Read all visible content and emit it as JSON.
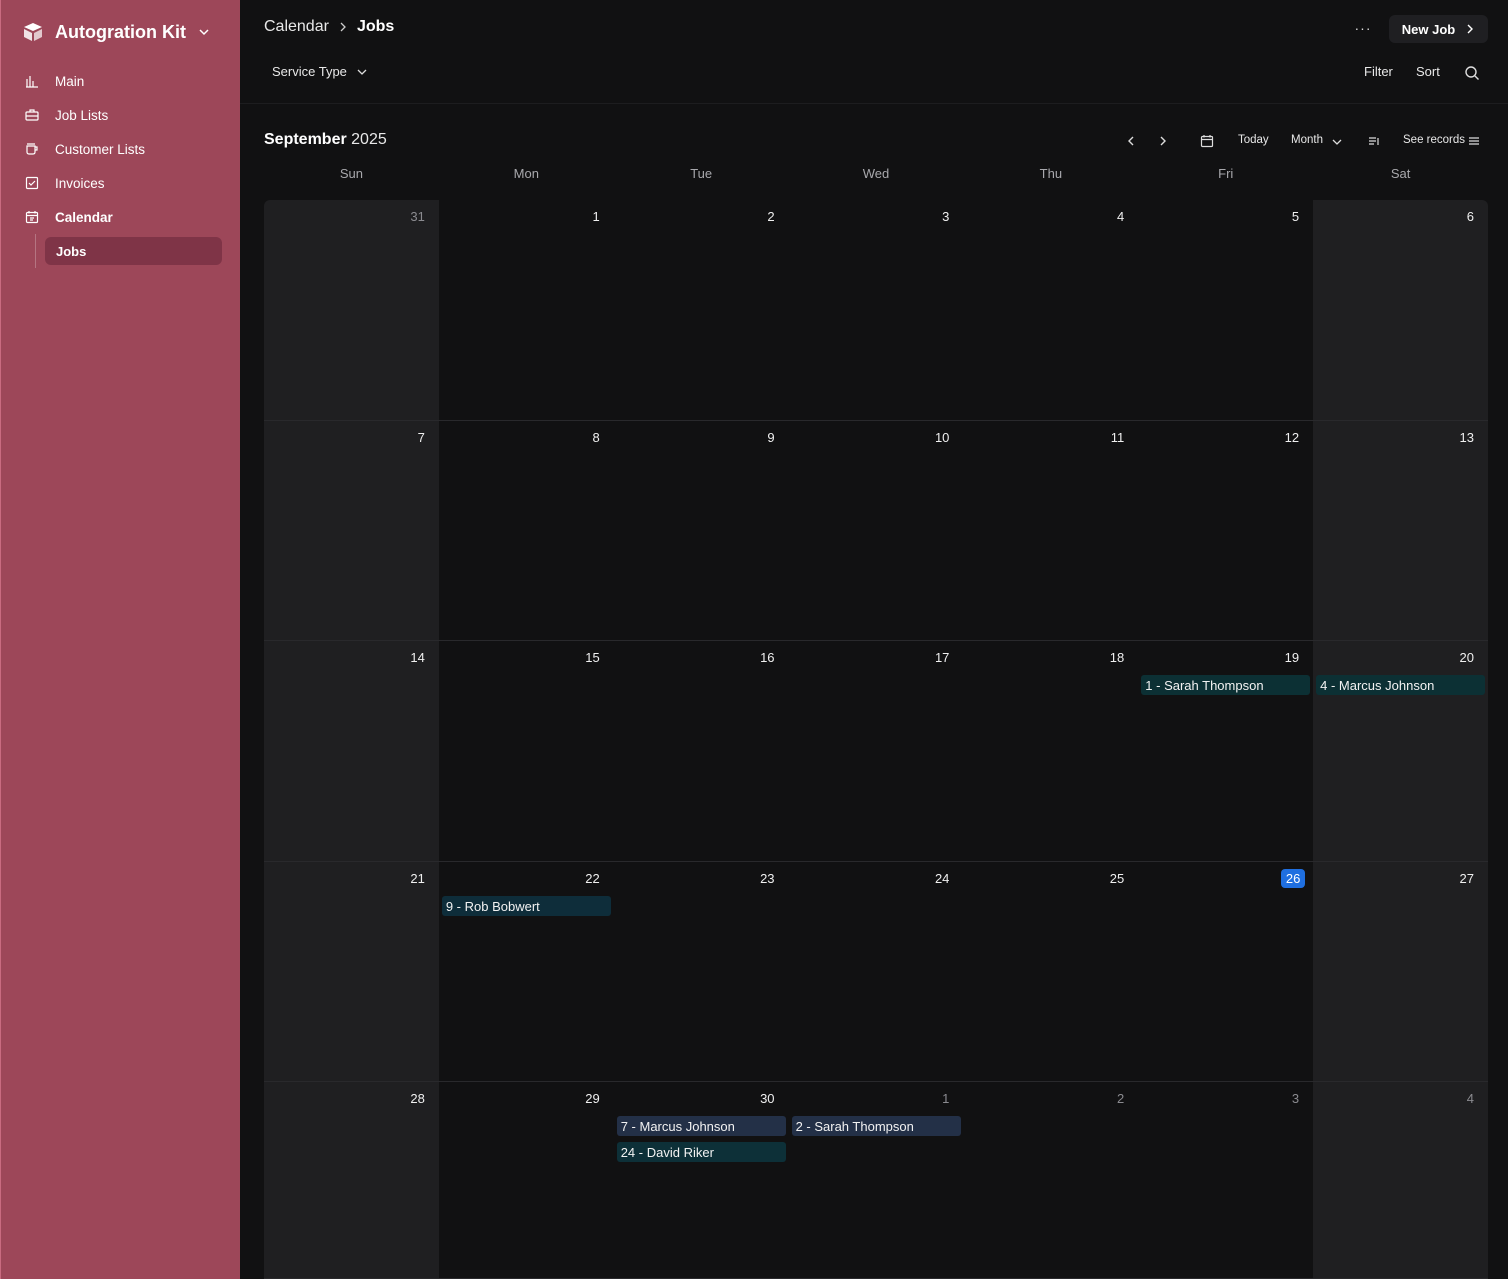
{
  "app": {
    "name": "Autogration Kit"
  },
  "sidebar": {
    "items": [
      {
        "label": "Main",
        "icon": "bar-chart-icon"
      },
      {
        "label": "Job Lists",
        "icon": "briefcase-icon"
      },
      {
        "label": "Customer Lists",
        "icon": "mug-icon"
      },
      {
        "label": "Invoices",
        "icon": "checkbox-icon"
      },
      {
        "label": "Calendar",
        "icon": "calendar-icon"
      }
    ],
    "sub_item": "Jobs"
  },
  "header": {
    "breadcrumb_parent": "Calendar",
    "breadcrumb_current": "Jobs",
    "more": "···",
    "new_job": "New Job",
    "service_type": "Service Type",
    "filter": "Filter",
    "sort": "Sort"
  },
  "calendar": {
    "month": "September",
    "year": "2025",
    "today_label": "Today",
    "view_label": "Month",
    "see_records": "See records",
    "weekdays": [
      "Sun",
      "Mon",
      "Tue",
      "Wed",
      "Thu",
      "Fri",
      "Sat"
    ],
    "weeks": [
      [
        {
          "d": "31",
          "out": true
        },
        {
          "d": "1"
        },
        {
          "d": "2"
        },
        {
          "d": "3"
        },
        {
          "d": "4"
        },
        {
          "d": "5"
        },
        {
          "d": "6"
        }
      ],
      [
        {
          "d": "7"
        },
        {
          "d": "8"
        },
        {
          "d": "9"
        },
        {
          "d": "10"
        },
        {
          "d": "11"
        },
        {
          "d": "12"
        },
        {
          "d": "13"
        }
      ],
      [
        {
          "d": "14"
        },
        {
          "d": "15"
        },
        {
          "d": "16"
        },
        {
          "d": "17"
        },
        {
          "d": "18"
        },
        {
          "d": "19",
          "events": [
            {
              "label": "1 - Sarah Thompson",
              "color": "#0c3034"
            }
          ]
        },
        {
          "d": "20",
          "events": [
            {
              "label": "4 - Marcus Johnson",
              "color": "#0c3034"
            }
          ]
        }
      ],
      [
        {
          "d": "21"
        },
        {
          "d": "22",
          "events": [
            {
              "label": "9 - Rob Bobwert",
              "color": "#0e2d3a"
            }
          ]
        },
        {
          "d": "23"
        },
        {
          "d": "24"
        },
        {
          "d": "25"
        },
        {
          "d": "26",
          "today": true
        },
        {
          "d": "27"
        }
      ],
      [
        {
          "d": "28"
        },
        {
          "d": "29"
        },
        {
          "d": "30",
          "events": [
            {
              "label": "7 - Marcus Johnson",
              "color": "#233047"
            },
            {
              "label": "24 - David Riker",
              "color": "#0d3038"
            }
          ]
        },
        {
          "d": "1",
          "out": true,
          "events": [
            {
              "label": "2 - Sarah Thompson",
              "color": "#233047"
            }
          ]
        },
        {
          "d": "2",
          "out": true
        },
        {
          "d": "3",
          "out": true
        },
        {
          "d": "4",
          "out": true
        }
      ]
    ]
  },
  "colors": {
    "sidebar": "#9d4759",
    "today": "#1f6fe0",
    "background": "#111112"
  }
}
